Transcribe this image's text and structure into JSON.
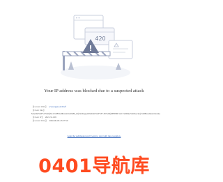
{
  "illustration": {
    "code": "420",
    "warning_glyph": "!",
    "warning_icon": "warning-triangle-icon",
    "accent": "#8a96b8",
    "stroke": "#c9cfde"
  },
  "message": "Your IP address was blocked due to a suspected attack",
  "info": {
    "client_url_key": "【Current URL】",
    "client_url_value": "www.cjpzs.cn/9c2f",
    "client_ua_key": "【Client Info】",
    "client_ua_value": "Mozilla%2F5.0%20(X11%3B%20Linux%20x86_64)%20AppleWebKit%2F537.36%20(KHTML%2C%20like%20Gecko)%20HeadlessChrome",
    "client_ip_key": "【Client IP】",
    "client_ip_value": "202.131.109",
    "time_key": "【Current Time】",
    "time_value": "2026-06-06 15:57:50"
  },
  "report_link": "Gain the webmaster and I want to deal with the exception.",
  "watermark": "0401导航库",
  "colors": {
    "watermark": "#ff4a1f",
    "link": "#2b5fb8"
  }
}
